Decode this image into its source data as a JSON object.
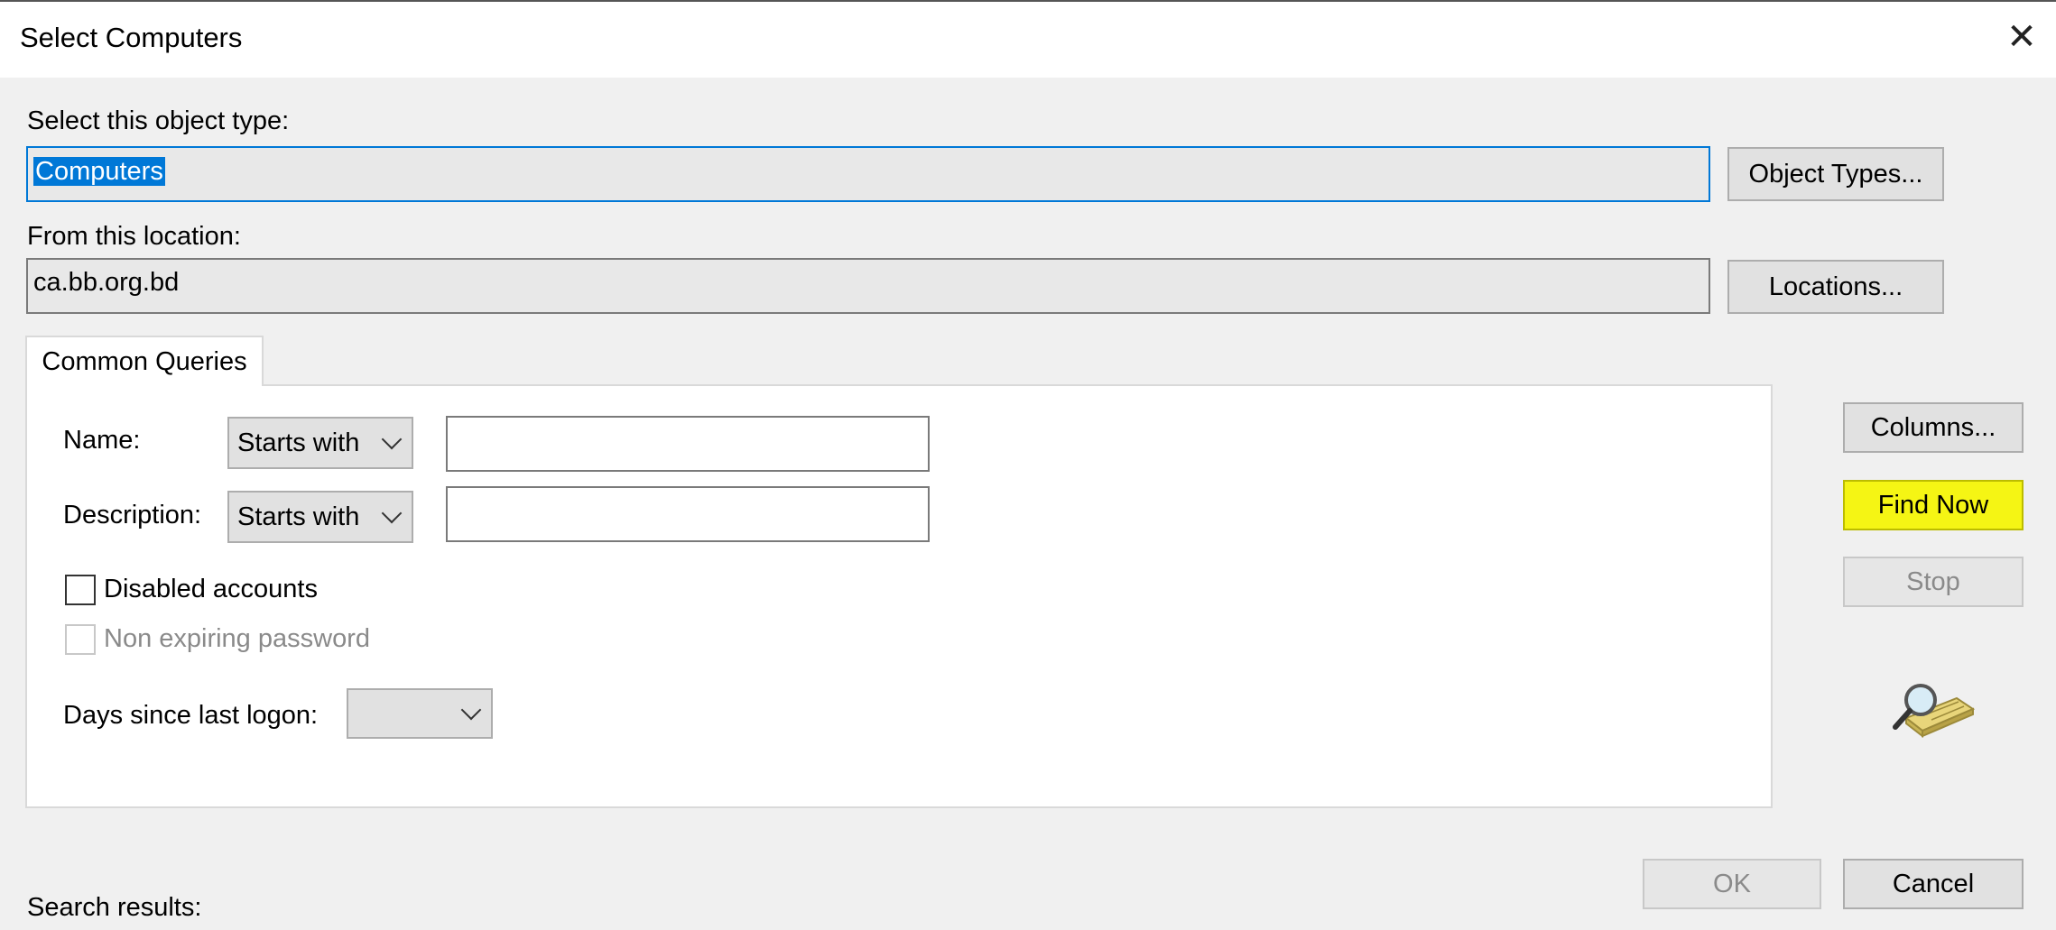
{
  "window": {
    "title": "Select Computers",
    "close_icon": "close-icon"
  },
  "object_type": {
    "label": "Select this object type:",
    "value": "Computers",
    "button": "Object Types..."
  },
  "location": {
    "label": "From this location:",
    "value": "ca.bb.org.bd",
    "button": "Locations..."
  },
  "tabs": [
    {
      "label": "Common Queries"
    }
  ],
  "queries": {
    "name_label": "Name:",
    "name_mode": "Starts with",
    "name_value": "",
    "description_label": "Description:",
    "description_mode": "Starts with",
    "description_value": "",
    "disabled_accounts_label": "Disabled accounts",
    "disabled_accounts_checked": false,
    "non_expiring_label": "Non expiring password",
    "non_expiring_checked": false,
    "days_label": "Days since last logon:",
    "days_value": ""
  },
  "side_buttons": {
    "columns": "Columns...",
    "find_now": "Find Now",
    "stop": "Stop",
    "search_icon": "magnifier-icon"
  },
  "footer": {
    "results_label": "Search results:",
    "ok": "OK",
    "cancel": "Cancel"
  },
  "colors": {
    "highlight": "#f5f514",
    "selection": "#0078d7"
  }
}
